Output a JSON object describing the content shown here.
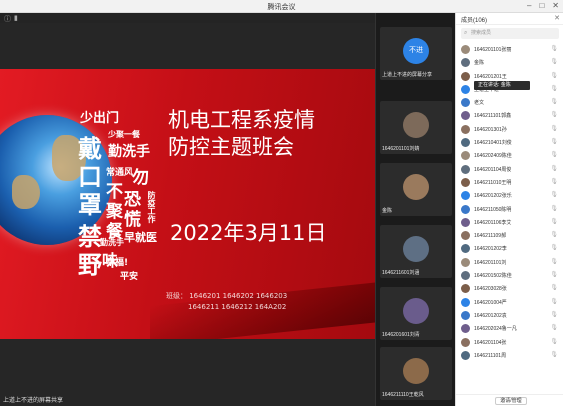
{
  "window": {
    "title": "腾讯会议"
  },
  "slide": {
    "title_line1": "机电工程系疫情",
    "title_line2": "防控主题班会",
    "date": "2022年3月11日",
    "classes_line1": "班级： 1646201 1646202 1646203",
    "classes_line2": "1646211 1646212 164A202",
    "words": [
      "少出门",
      "戴",
      "口",
      "罩",
      "禁",
      "野",
      "少聚一餐",
      "勤洗手",
      "常通风",
      "不",
      "聚",
      "餐",
      "勿",
      "恐",
      "慌",
      "防疫工作",
      "早就医",
      "勤洗手",
      "幸福!",
      "味",
      "平安"
    ]
  },
  "stage_footer": "上道上不进的屏幕共享",
  "videos": [
    {
      "name": "不进",
      "caption": "上道上不进的屏幕分享"
    },
    {
      "name": "",
      "caption": "1646201101刘婧"
    },
    {
      "name": "",
      "caption": "金陈"
    },
    {
      "name": "",
      "caption": "1646211601刘涵"
    },
    {
      "name": "",
      "caption": "1646201601刘青"
    },
    {
      "name": "",
      "caption": "1646211110王乾风"
    }
  ],
  "panel": {
    "title": "成员(106)",
    "search_placeholder": "搜索成员",
    "tooltip": "正在讲话: 金陈",
    "footer_button": "邀请/管理",
    "members": [
      "1646201101张丽",
      "金陈",
      "1646201201王",
      "上道上不进",
      "老文",
      "1646211101郭鑫",
      "1646201301孙",
      "1646210401刘俊",
      "1646202409陈佳",
      "1646201104周俊",
      "1646211010王明",
      "1646201202张乐",
      "1646211050陈明",
      "1646201106李艾",
      "1646211109郝",
      "1646201202李",
      "1646201101刘",
      "1646201502陈佳",
      "1646203028张",
      "1646201004严",
      "1646201202袁",
      "1646202024鲁一凡",
      "1646201104张",
      "1646211101周"
    ]
  }
}
